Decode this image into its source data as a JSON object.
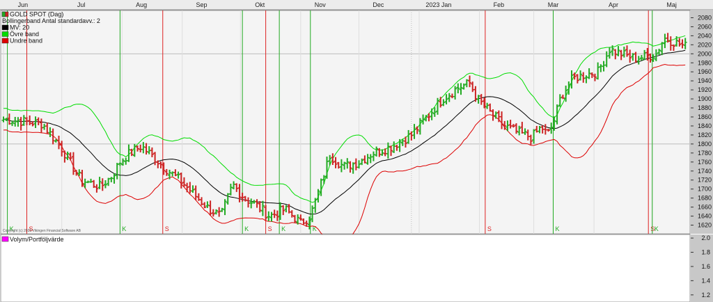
{
  "chart_data": {
    "type": "ohlc",
    "instrument": "GOLD SPOT (Dag)",
    "legend": [
      {
        "label": "GOLD SPOT (Dag)",
        "color": "#cc2222"
      },
      {
        "label": "Bollingerband  Antal standardavv.: 2",
        "color": ""
      },
      {
        "label": "MV: 20",
        "color": "#000000"
      },
      {
        "label": "Övre band",
        "color": "#00dd00"
      },
      {
        "label": "Undre band",
        "color": "#dd0000"
      }
    ],
    "volume_label": "Volym/Portföljvärde",
    "volume_color": "#ff00ff",
    "copyright": "Copyright (c) 2023 Vikingen Financial Software AB",
    "months": [
      {
        "label": "Jun",
        "day": 10
      },
      {
        "label": "Jul",
        "day": 40
      },
      {
        "label": "Aug",
        "day": 71
      },
      {
        "label": "Sep",
        "day": 102
      },
      {
        "label": "Okt",
        "day": 132
      },
      {
        "label": "Nov",
        "day": 163
      },
      {
        "label": "Dec",
        "day": 193
      },
      {
        "label": "2023 Jan",
        "day": 224
      },
      {
        "label": "Feb",
        "day": 255
      },
      {
        "label": "Mar",
        "day": 283
      },
      {
        "label": "Apr",
        "day": 314
      },
      {
        "label": "Maj",
        "day": 344
      }
    ],
    "xlim": [
      0,
      352
    ],
    "price_axis": {
      "ylim": [
        1610,
        2090
      ],
      "ticks": [
        1620,
        1640,
        1660,
        1680,
        1700,
        1720,
        1740,
        1760,
        1780,
        1800,
        1820,
        1840,
        1860,
        1880,
        1900,
        1920,
        1940,
        1960,
        1980,
        2000,
        2020,
        2040,
        2060,
        2080
      ]
    },
    "volume_axis": {
      "ylim": [
        1.1,
        2.05
      ],
      "ticks": [
        "2.0",
        "1.8",
        "1.6",
        "1.4",
        "1.2"
      ]
    },
    "price_keypoints": [
      [
        0,
        1855
      ],
      [
        10,
        1850
      ],
      [
        20,
        1845
      ],
      [
        30,
        1790
      ],
      [
        40,
        1720
      ],
      [
        50,
        1705
      ],
      [
        56,
        1730
      ],
      [
        60,
        1760
      ],
      [
        65,
        1780
      ],
      [
        71,
        1795
      ],
      [
        78,
        1768
      ],
      [
        85,
        1740
      ],
      [
        92,
        1715
      ],
      [
        100,
        1680
      ],
      [
        106,
        1655
      ],
      [
        112,
        1640
      ],
      [
        118,
        1710
      ],
      [
        124,
        1680
      ],
      [
        130,
        1665
      ],
      [
        137,
        1640
      ],
      [
        145,
        1655
      ],
      [
        153,
        1625
      ],
      [
        158,
        1640
      ],
      [
        163,
        1705
      ],
      [
        168,
        1775
      ],
      [
        175,
        1750
      ],
      [
        183,
        1760
      ],
      [
        190,
        1780
      ],
      [
        200,
        1795
      ],
      [
        210,
        1820
      ],
      [
        218,
        1860
      ],
      [
        226,
        1900
      ],
      [
        234,
        1925
      ],
      [
        240,
        1935
      ],
      [
        244,
        1900
      ],
      [
        250,
        1872
      ],
      [
        258,
        1840
      ],
      [
        265,
        1825
      ],
      [
        272,
        1815
      ],
      [
        277,
        1838
      ],
      [
        280,
        1820
      ],
      [
        283,
        1845
      ],
      [
        287,
        1905
      ],
      [
        293,
        1945
      ],
      [
        300,
        1955
      ],
      [
        306,
        1960
      ],
      [
        312,
        2010
      ],
      [
        318,
        2000
      ],
      [
        325,
        1990
      ],
      [
        332,
        1995
      ],
      [
        336,
        2000
      ],
      [
        340,
        2035
      ],
      [
        346,
        2025
      ],
      [
        352,
        2015
      ]
    ],
    "signals": [
      {
        "day": 2,
        "type": "K"
      },
      {
        "day": 12,
        "type": "S"
      },
      {
        "day": 60,
        "type": "K"
      },
      {
        "day": 82,
        "type": "S"
      },
      {
        "day": 123,
        "type": "K"
      },
      {
        "day": 135,
        "type": "S"
      },
      {
        "day": 142,
        "type": "K"
      },
      {
        "day": 158,
        "type": "K"
      },
      {
        "day": 248,
        "type": "S"
      },
      {
        "day": 283,
        "type": "K"
      },
      {
        "day": 332,
        "type": "S"
      },
      {
        "day": 334,
        "type": "K"
      }
    ],
    "colors": {
      "up": "#22aa22",
      "down": "#cc2222",
      "ma": "#000000",
      "upper_band": "#00dd00",
      "lower_band": "#dd0000",
      "buy_line": "#22aa22",
      "sell_line": "#dd2222"
    }
  }
}
